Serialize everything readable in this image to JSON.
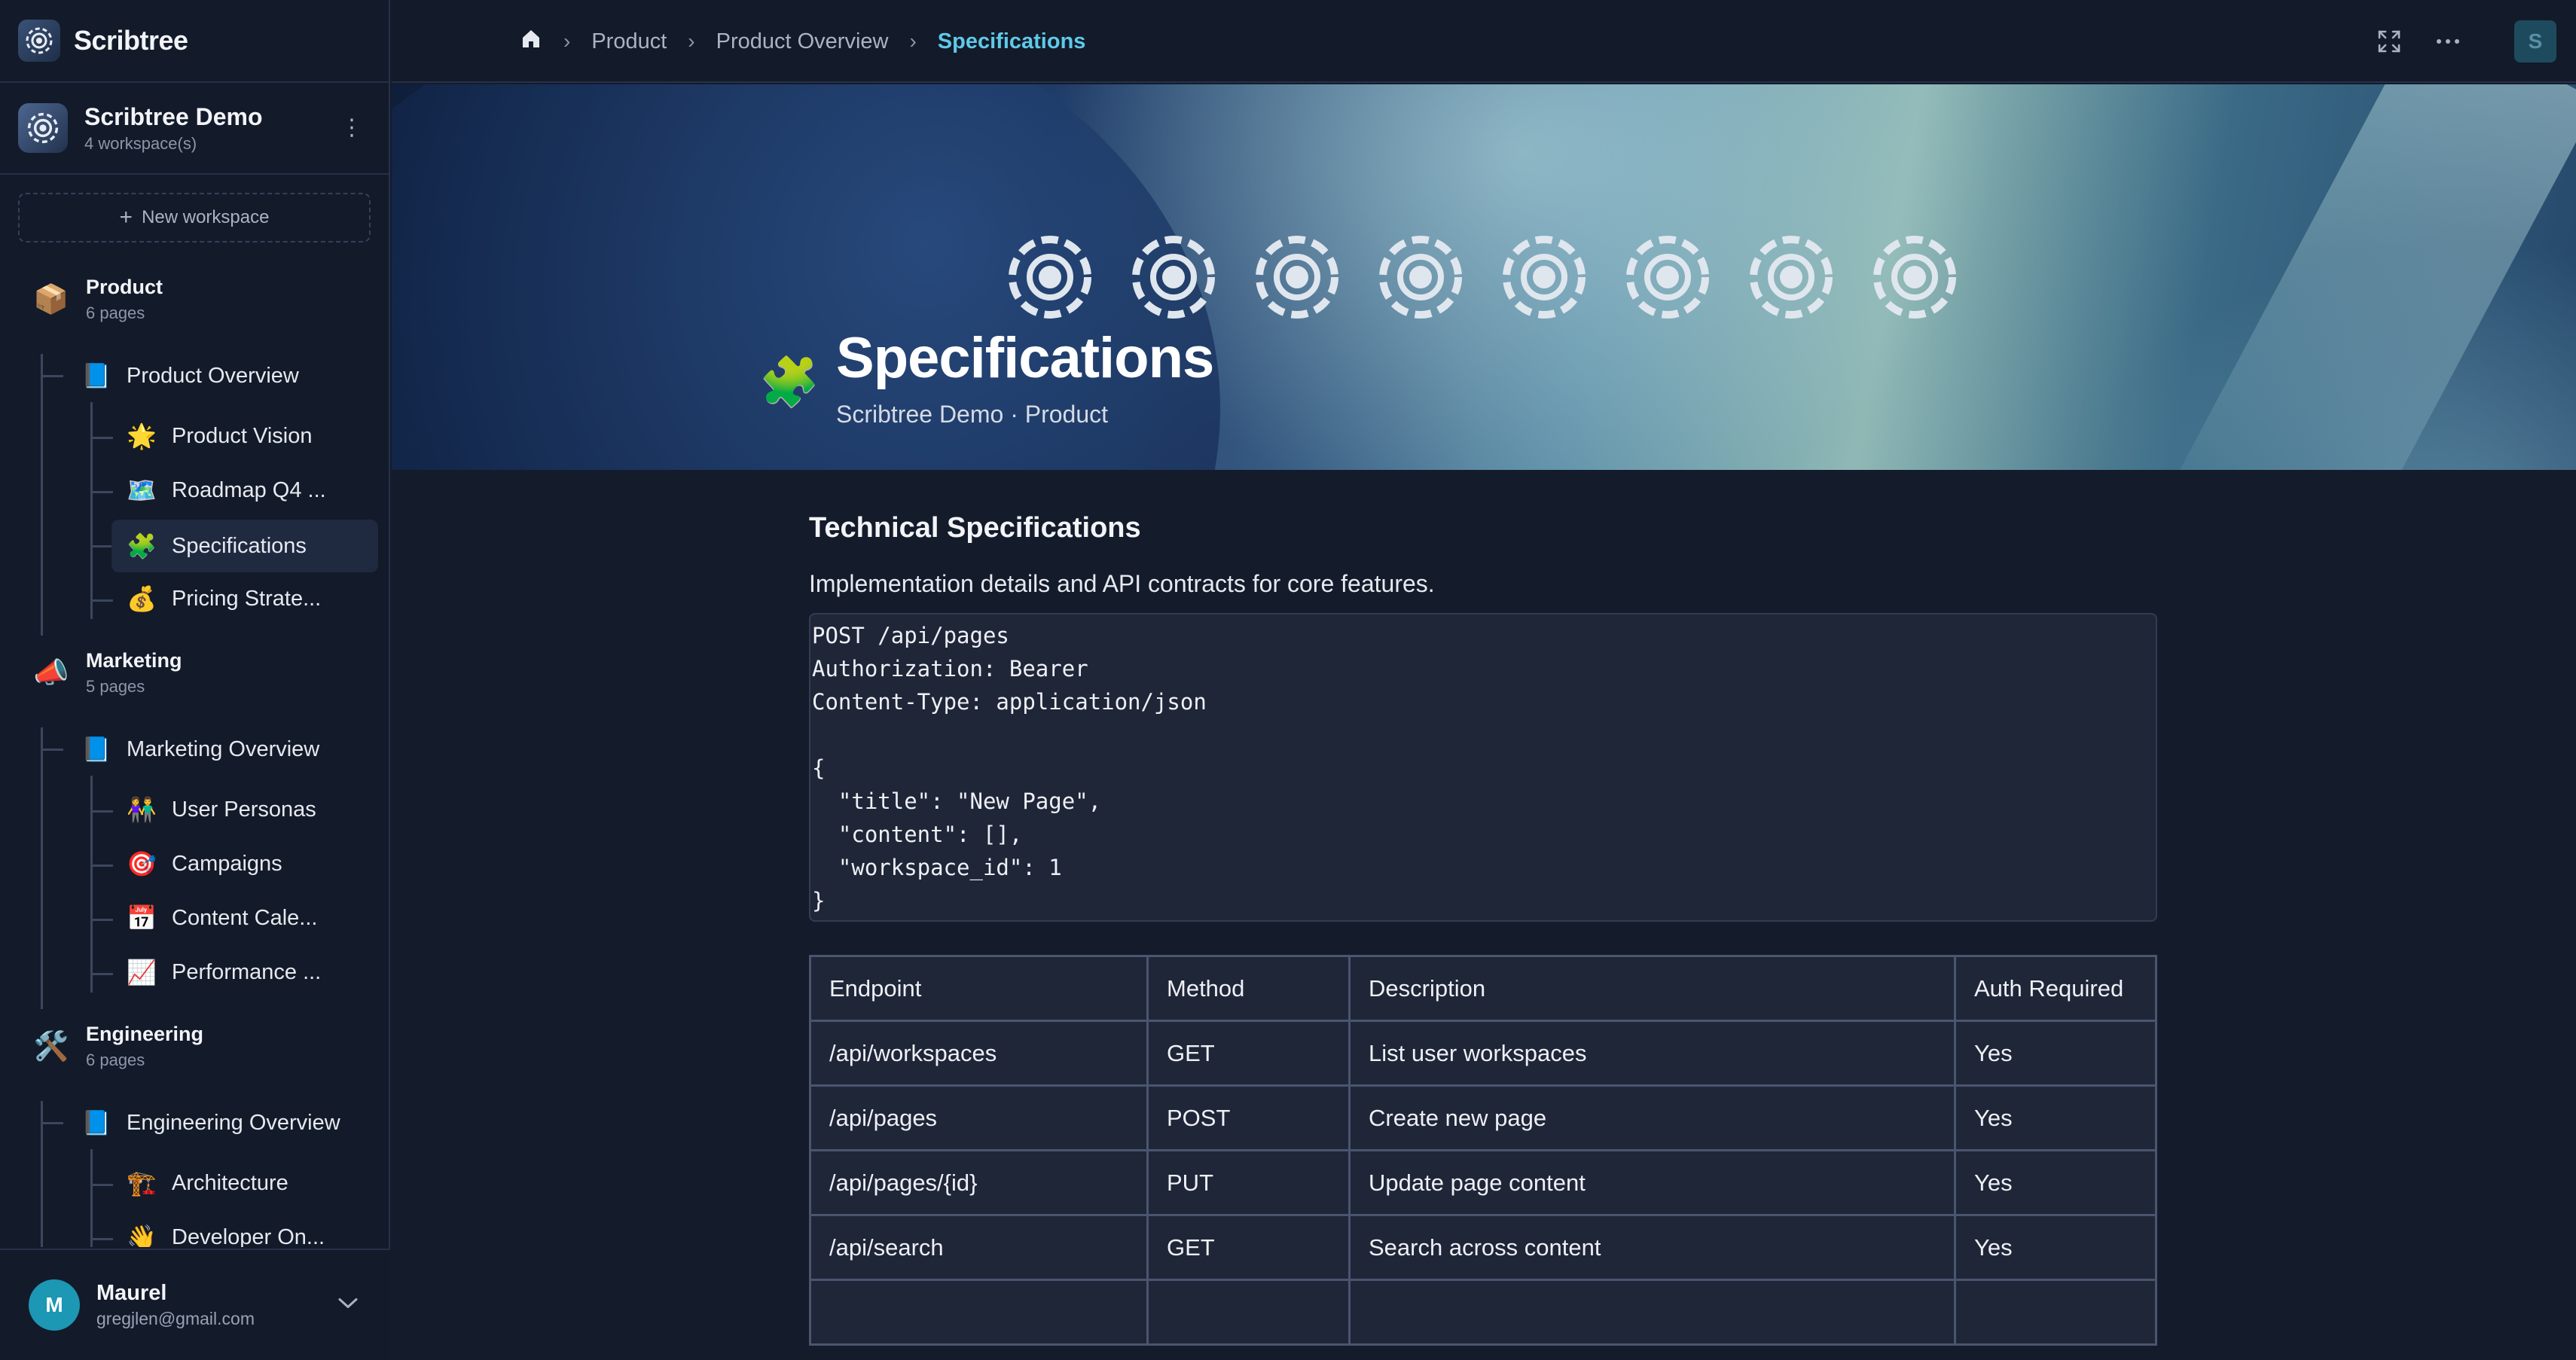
{
  "app": {
    "name": "Scribtree"
  },
  "workspace": {
    "name": "Scribtree Demo",
    "count_label": "4 workspace(s)",
    "new_label": "New workspace"
  },
  "groups": [
    {
      "emoji": "📦",
      "title": "Product",
      "count": "6 pages",
      "overview": {
        "emoji": "📘",
        "label": "Product Overview"
      },
      "children": [
        {
          "emoji": "🌟",
          "label": "Product Vision"
        },
        {
          "emoji": "🗺️",
          "label": "Roadmap Q4 ..."
        },
        {
          "emoji": "🧩",
          "label": "Specifications",
          "active": true
        },
        {
          "emoji": "💰",
          "label": "Pricing Strate..."
        }
      ]
    },
    {
      "emoji": "📣",
      "title": "Marketing",
      "count": "5 pages",
      "overview": {
        "emoji": "📘",
        "label": "Marketing Overview"
      },
      "children": [
        {
          "emoji": "👫",
          "label": "User Personas"
        },
        {
          "emoji": "🎯",
          "label": "Campaigns"
        },
        {
          "emoji": "📅",
          "label": "Content Cale..."
        },
        {
          "emoji": "📈",
          "label": "Performance ..."
        }
      ]
    },
    {
      "emoji": "🛠️",
      "title": "Engineering",
      "count": "6 pages",
      "overview": {
        "emoji": "📘",
        "label": "Engineering Overview"
      },
      "children": [
        {
          "emoji": "🏗️",
          "label": "Architecture"
        },
        {
          "emoji": "👋",
          "label": "Developer On..."
        }
      ]
    }
  ],
  "user": {
    "initial": "M",
    "name": "Maurel",
    "email": "gregjlen@gmail.com"
  },
  "breadcrumb": {
    "items": [
      "Product",
      "Product Overview"
    ],
    "current": "Specifications"
  },
  "topbar": {
    "avatar_initial": "S"
  },
  "page": {
    "emoji": "🧩",
    "title": "Specifications",
    "subtitle": "Scribtree Demo · Product",
    "heading": "Technical Specifications",
    "paragraph": "Implementation details and API contracts for core features.",
    "code": "POST /api/pages\nAuthorization: Bearer\nContent-Type: application/json\n\n{\n  \"title\": \"New Page\",\n  \"content\": [],\n  \"workspace_id\": 1\n}",
    "table": {
      "headers": [
        "Endpoint",
        "Method",
        "Description",
        "Auth Required"
      ],
      "rows": [
        [
          "/api/workspaces",
          "GET",
          "List user workspaces",
          "Yes"
        ],
        [
          "/api/pages",
          "POST",
          "Create new page",
          "Yes"
        ],
        [
          "/api/pages/{id}",
          "PUT",
          "Update page content",
          "Yes"
        ],
        [
          "/api/search",
          "GET",
          "Search across content",
          "Yes"
        ],
        [
          "",
          "",
          "",
          ""
        ]
      ]
    }
  },
  "colors": {
    "accent": "#5fc9e8",
    "avatar": "#1c97b4",
    "sidebar_bg": "#131a29",
    "code_bg": "#1e2638"
  }
}
